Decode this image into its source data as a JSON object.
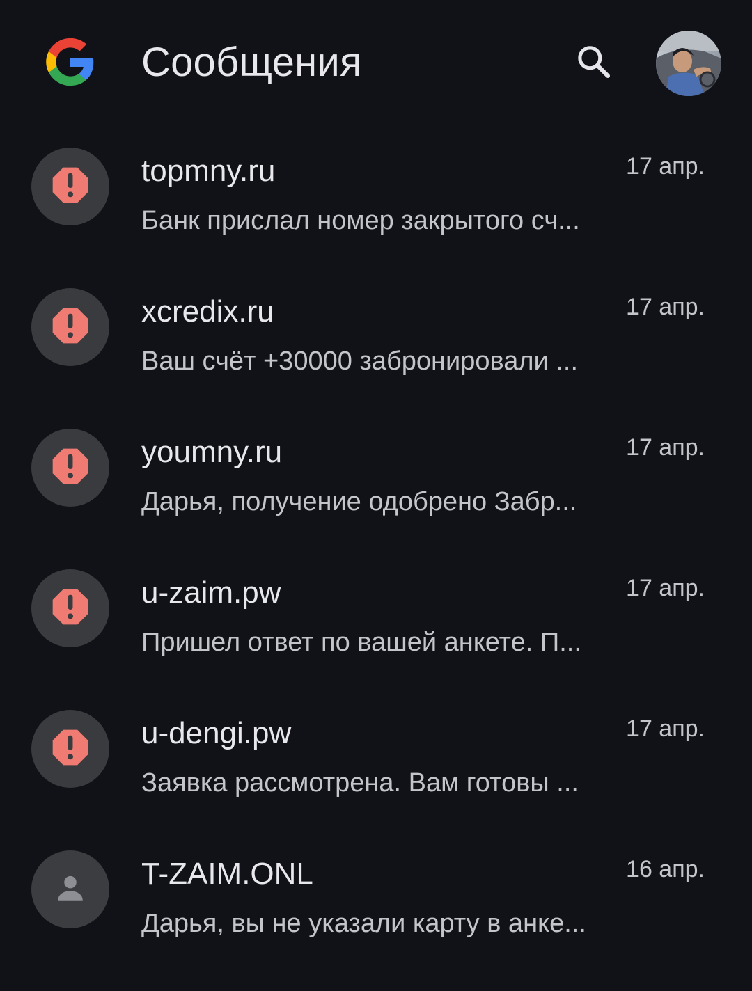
{
  "app_bar": {
    "title": "Сообщения",
    "logo_icon": "google-g-icon",
    "search_icon": "search-icon",
    "account_icon": "account-avatar"
  },
  "colors": {
    "background": "#101217",
    "spam_badge": "#ef7b73",
    "avatar_circle": "#3a3b3f",
    "primary_text": "#e8e8ec",
    "secondary_text": "#c4c5ca"
  },
  "conversations": [
    {
      "sender": "topmny.ru",
      "preview": "Банк прислал номер закрытого сч...",
      "date": "17 апр.",
      "avatar_type": "spam-warning-icon"
    },
    {
      "sender": "xcredix.ru",
      "preview": "Ваш счёт +30000 забронировали ...",
      "date": "17 апр.",
      "avatar_type": "spam-warning-icon"
    },
    {
      "sender": "youmny.ru",
      "preview": "Дарья, получение одобрено Забр...",
      "date": "17 апр.",
      "avatar_type": "spam-warning-icon"
    },
    {
      "sender": "u-zaim.pw",
      "preview": "Пришел ответ по вашей анкете. П...",
      "date": "17 апр.",
      "avatar_type": "spam-warning-icon"
    },
    {
      "sender": "u-dengi.pw",
      "preview": "Заявка рассмотрена. Вам готовы ...",
      "date": "17 апр.",
      "avatar_type": "spam-warning-icon"
    },
    {
      "sender": "T-ZAIM.ONL",
      "preview": "Дарья, вы не указали карту в анке...",
      "date": "16 апр.",
      "avatar_type": "person-icon"
    }
  ]
}
